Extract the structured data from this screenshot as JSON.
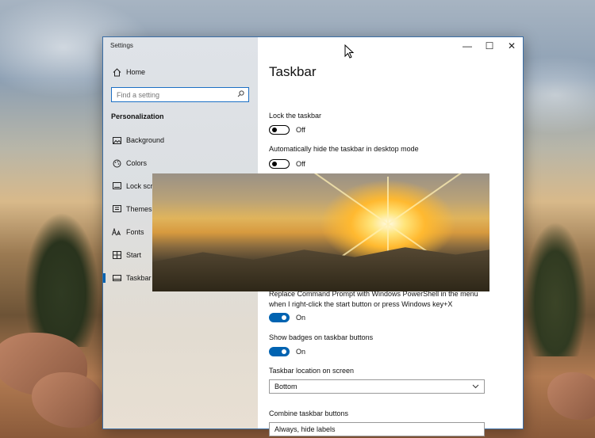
{
  "window": {
    "title": "Settings"
  },
  "caption_buttons": {
    "minimize": "—",
    "maximize": "☐",
    "close": "✕"
  },
  "sidebar": {
    "home_label": "Home",
    "search_placeholder": "Find a setting",
    "group_title": "Personalization",
    "items": [
      {
        "label": "Background",
        "icon": "image-icon"
      },
      {
        "label": "Colors",
        "icon": "palette-icon"
      },
      {
        "label": "Lock screen",
        "icon": "lock-screen-icon"
      },
      {
        "label": "Themes",
        "icon": "themes-icon"
      },
      {
        "label": "Fonts",
        "icon": "fonts-icon"
      },
      {
        "label": "Start",
        "icon": "start-icon"
      },
      {
        "label": "Taskbar",
        "icon": "taskbar-icon",
        "selected": true
      }
    ]
  },
  "content": {
    "heading": "Taskbar",
    "settings": [
      {
        "label": "Lock the taskbar",
        "state": "Off"
      },
      {
        "label": "Automatically hide the taskbar in desktop mode",
        "state": "Off"
      },
      {
        "label_line1": "Replace Command Prompt with Windows PowerShell in the menu",
        "label_line2": "when I right-click the start button or press Windows key+X",
        "state": "On"
      },
      {
        "label": "Show badges on taskbar buttons",
        "state": "On"
      }
    ],
    "location": {
      "label": "Taskbar location on screen",
      "value": "Bottom"
    },
    "combine": {
      "label": "Combine taskbar buttons",
      "value": "Always, hide labels"
    }
  },
  "colors": {
    "accent": "#0063b1",
    "window_border": "#3b6ea5"
  }
}
